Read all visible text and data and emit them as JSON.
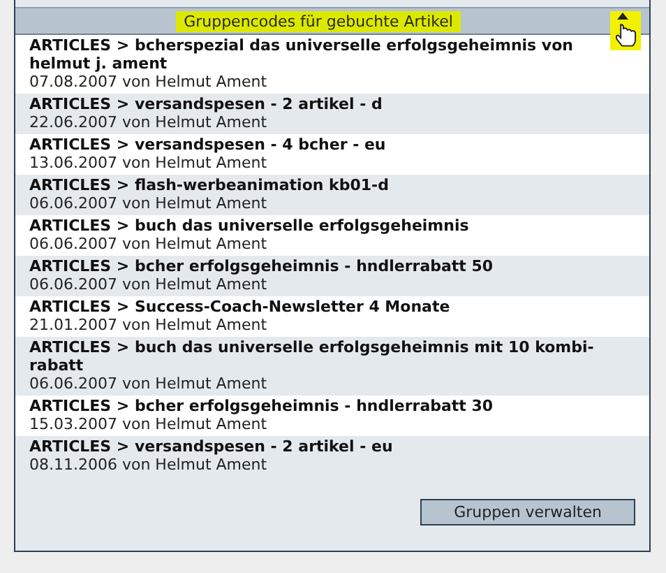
{
  "panel": {
    "title": "Gruppencodes für gebuchte Artikel",
    "items": [
      {
        "title": "ARTICLES > bcherspezial das universelle erfolgsgeheimnis von helmut j. ament",
        "meta": "07.08.2007 von Helmut Ament"
      },
      {
        "title": "ARTICLES > versandspesen - 2 artikel - d",
        "meta": "22.06.2007 von Helmut Ament"
      },
      {
        "title": "ARTICLES > versandspesen - 4 bcher - eu",
        "meta": "13.06.2007 von Helmut Ament"
      },
      {
        "title": "ARTICLES > flash-werbeanimation kb01-d",
        "meta": "06.06.2007 von Helmut Ament"
      },
      {
        "title": "ARTICLES > buch das universelle erfolgsgeheimnis",
        "meta": "06.06.2007 von Helmut Ament"
      },
      {
        "title": "ARTICLES > bcher erfolgsgeheimnis - hndlerrabatt 50",
        "meta": "06.06.2007 von Helmut Ament"
      },
      {
        "title": "ARTICLES > Success-Coach-Newsletter 4 Monate",
        "meta": "21.01.2007 von Helmut Ament"
      },
      {
        "title": "ARTICLES > buch das universelle erfolgsgeheimnis mit 10 kombi-rabatt",
        "meta": "06.06.2007 von Helmut Ament"
      },
      {
        "title": "ARTICLES > bcher erfolgsgeheimnis - hndlerrabatt 30",
        "meta": "15.03.2007 von Helmut Ament"
      },
      {
        "title": "ARTICLES > versandspesen - 2 artikel - eu",
        "meta": "08.11.2006 von Helmut Ament"
      }
    ],
    "button": "Gruppen verwalten"
  }
}
